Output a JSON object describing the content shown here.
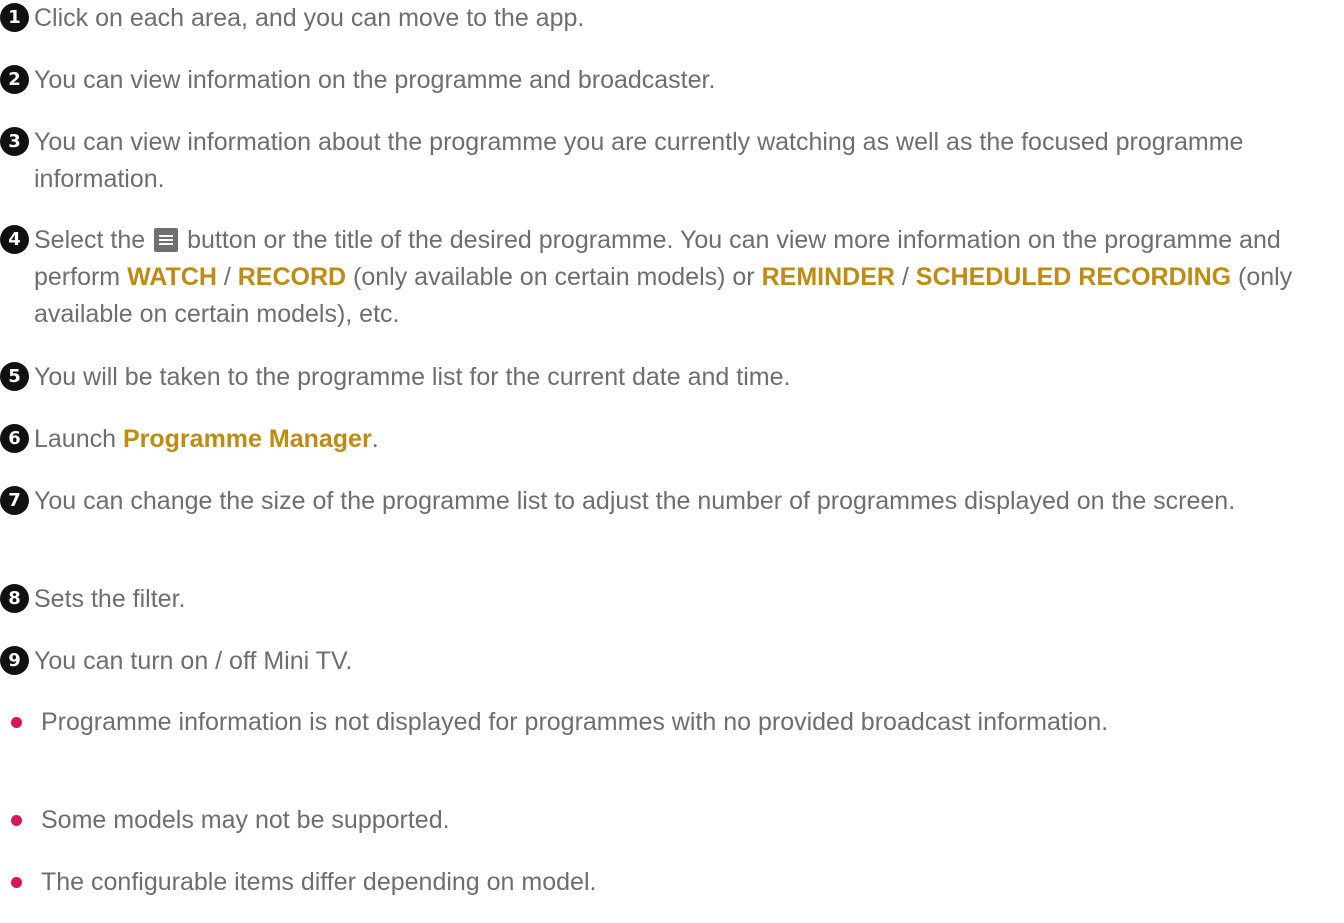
{
  "steps": [
    {
      "num": "1",
      "text": "Click on each area, and you can move to the app."
    },
    {
      "num": "2",
      "text": "You can view information on the programme and broadcaster."
    },
    {
      "num": "3",
      "text": "You can view information about the programme you are currently watching as well as the focused programme information."
    },
    {
      "num": "4",
      "part1": "Select the",
      "icon": "menu-icon",
      "part2": "button or the title of the desired programme. You can view more information on the programme and perform",
      "watch": "WATCH",
      "sep1": "/",
      "record": "RECORD",
      "part3": "(only available on certain models) or",
      "reminder": "REMINDER",
      "sep2": "/",
      "scheduled": "SCHEDULED RECORDING",
      "part4": "(only available on certain models), etc."
    },
    {
      "num": "5",
      "text": "You will be taken to the programme list for the current date and time."
    },
    {
      "num": "6",
      "part1": "Launch",
      "highlight": "Programme Manager",
      "part2": "."
    },
    {
      "num": "7",
      "text": "You can change the size of the programme list to adjust the number of programmes displayed on the screen."
    },
    {
      "num": "8",
      "text": "Sets the filter."
    },
    {
      "num": "9",
      "text": "You can turn on / off Mini TV."
    }
  ],
  "notes": [
    "Programme information is not displayed for programmes with no provided broadcast information.",
    "Some models may not be supported.",
    "The configurable items differ depending on model."
  ],
  "colors": {
    "text": "#6e6e6e",
    "highlight": "#c08b12",
    "badge": "#111111",
    "bullet": "#d6175e"
  }
}
